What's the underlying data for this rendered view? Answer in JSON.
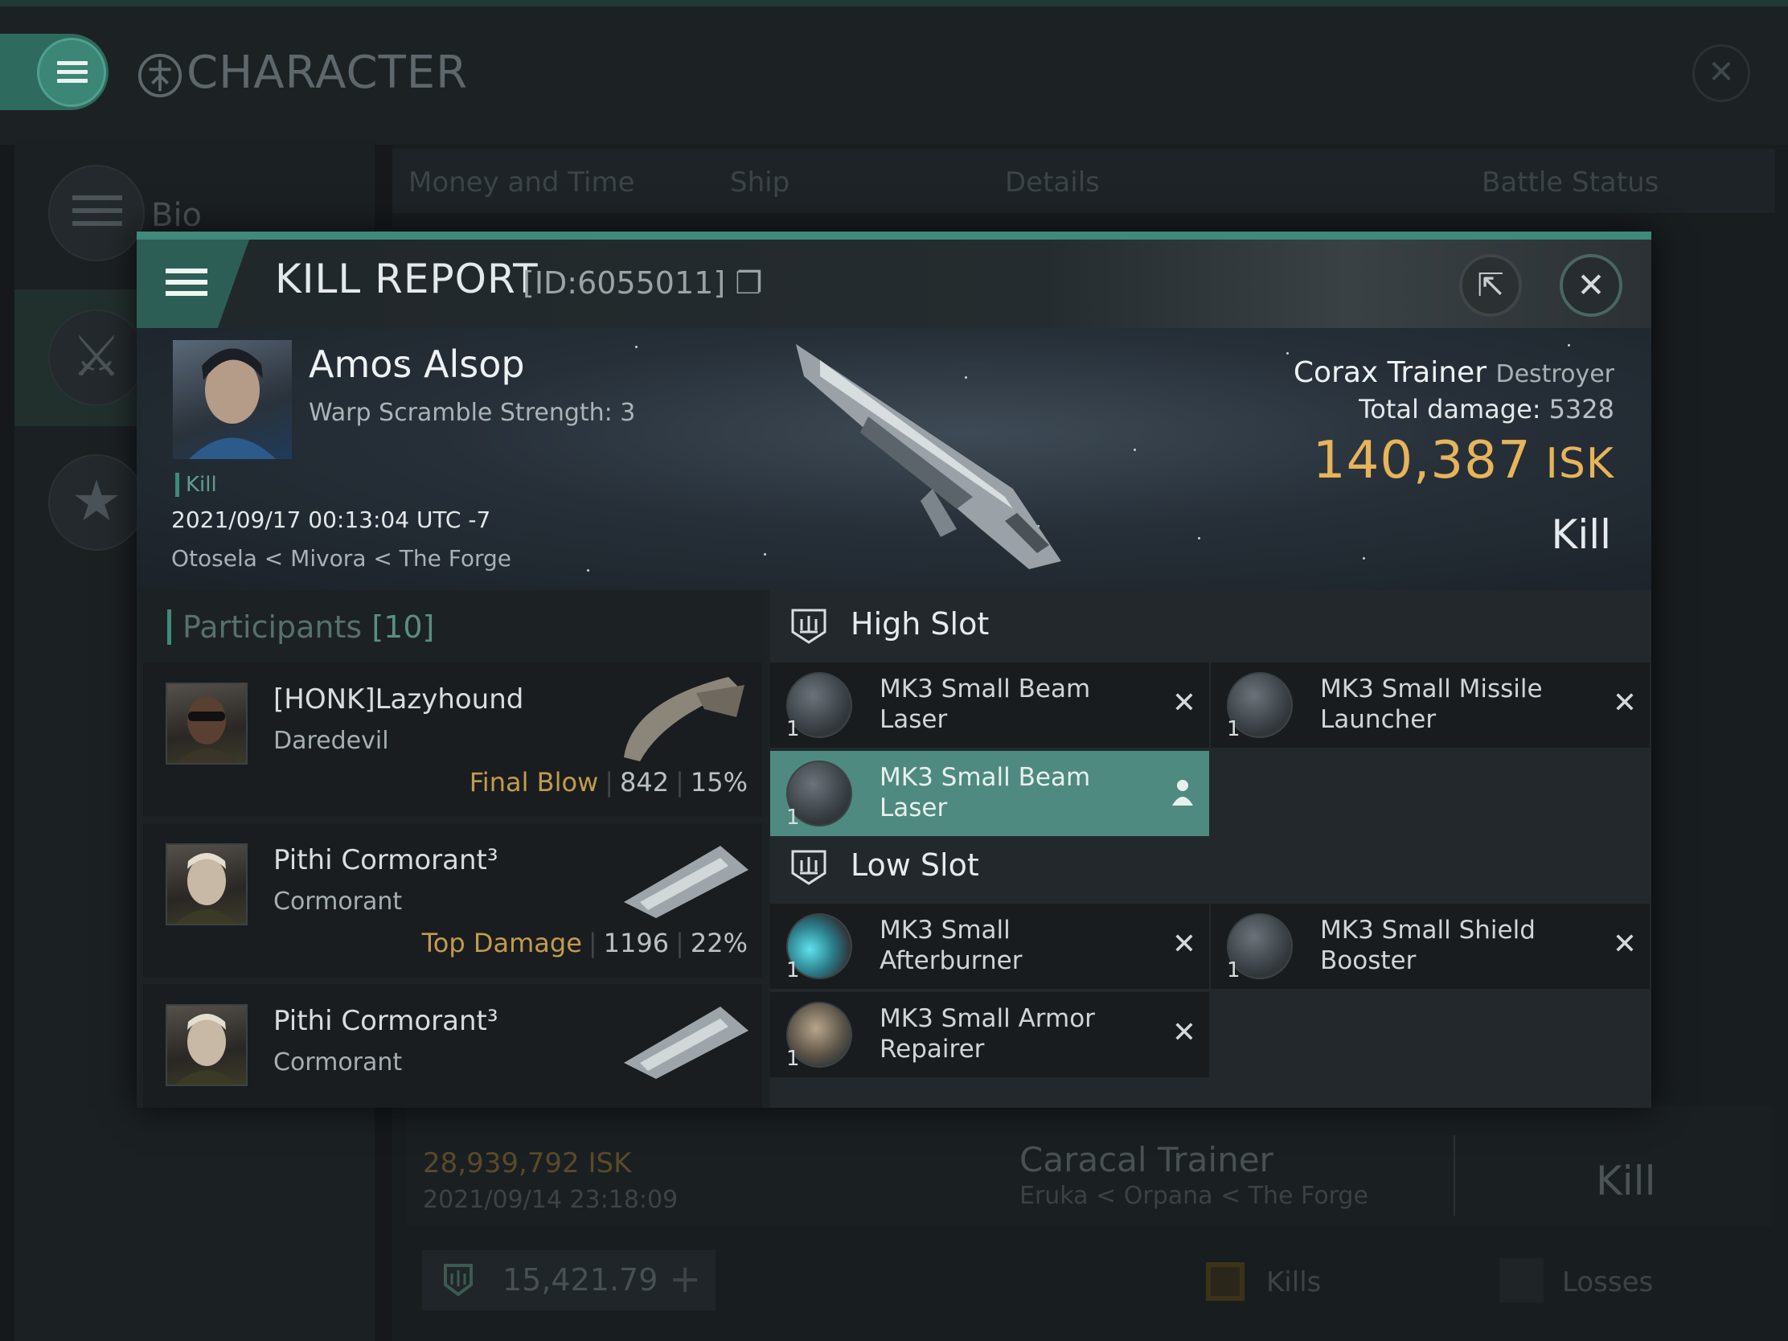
{
  "screen": {
    "title": "CHARACTER",
    "sidenav": [
      {
        "label": "Bio"
      }
    ],
    "tabs": [
      "Money and Time",
      "Ship",
      "Details",
      "Battle Status"
    ],
    "bg_entry": {
      "isk": "28,939,792  ISK",
      "date": "2021/09/14  23:18:09",
      "ship": "Caracal Trainer",
      "location": "Eruka < Orpana < The Forge",
      "result": "Kill"
    },
    "wallet": "15,421.79",
    "filters": {
      "kills": "Kills",
      "losses": "Losses"
    }
  },
  "report": {
    "title": "KILL REPORT",
    "id": "[ID:6055011]",
    "victim": {
      "name": "Amos Alsop",
      "sub": "Warp Scramble Strength: 3",
      "tag": "Kill",
      "date": "2021/09/17 00:13:04 UTC -7",
      "location": "Otosela < Mivora < The Forge"
    },
    "ship": {
      "name": "Corax Trainer",
      "class": "Destroyer"
    },
    "damage_label": "Total damage:",
    "damage": "5328",
    "isk_value": "140,387",
    "isk_unit": "ISK",
    "result": "Kill"
  },
  "participants": {
    "label": "Participants",
    "count": "[10]",
    "rows": [
      {
        "name": "[HONK]Lazyhound",
        "ship": "Daredevil",
        "tag": "Final Blow",
        "damage": "842",
        "pct": "15%"
      },
      {
        "name": "Pithi Cormorant³",
        "ship": "Cormorant",
        "tag": "Top Damage",
        "damage": "1196",
        "pct": "22%"
      },
      {
        "name": "Pithi Cormorant³",
        "ship": "Cormorant",
        "tag": "",
        "damage": "",
        "pct": ""
      }
    ]
  },
  "fitting": {
    "high_label": "High Slot",
    "low_label": "Low Slot",
    "high": [
      {
        "name": "MK3 Small Beam Laser",
        "qty": "1"
      },
      {
        "name": "MK3 Small Missile Launcher",
        "qty": "1"
      },
      {
        "name": "MK3 Small Beam Laser",
        "qty": "1"
      }
    ],
    "low": [
      {
        "name": "MK3 Small Afterburner",
        "qty": "1"
      },
      {
        "name": "MK3 Small Shield Booster",
        "qty": "1"
      },
      {
        "name": "MK3 Small Armor Repairer",
        "qty": "1"
      }
    ]
  },
  "colors": {
    "accent": "#3f8a7a",
    "isk": "#e7b45a",
    "selected": "#4e8a7f"
  }
}
